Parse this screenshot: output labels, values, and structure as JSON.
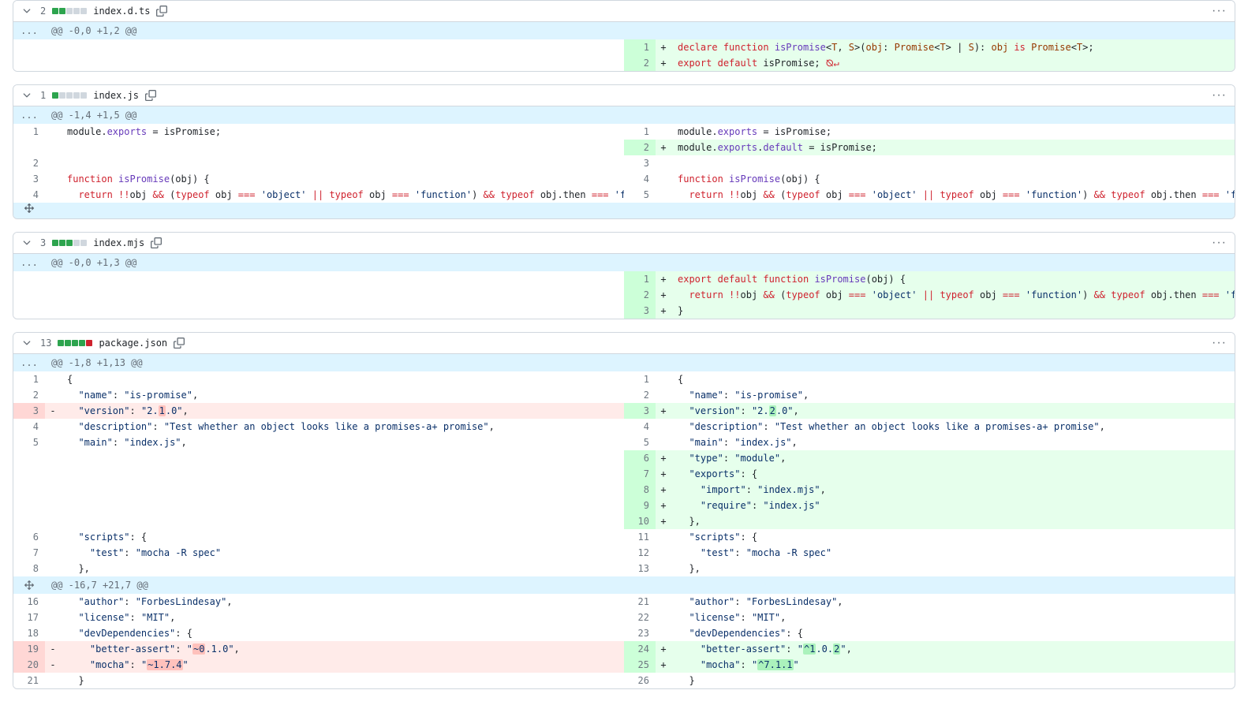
{
  "files": [
    {
      "id": "f0",
      "filename": "index.d.ts",
      "change_count": "2",
      "blocks": [
        "add",
        "add",
        "neutral",
        "neutral",
        "neutral"
      ],
      "hunks": [
        {
          "header": "@@ -0,0 +1,2 @@",
          "left": [],
          "right": [
            {
              "n": "1",
              "m": "+",
              "type": "add",
              "html": "<span class='kw'>declare</span> <span class='kw'>function</span> <span class='fn'>isPromise</span>&lt;<span class='type'>T</span>, <span class='type'>S</span>&gt;(<span class='type'>obj</span>: <span class='type'>Promise</span>&lt;<span class='type'>T</span>&gt; | <span class='type'>S</span>): <span class='type'>obj</span> <span class='kw'>is</span> <span class='type'>Promise</span>&lt;<span class='type'>T</span>&gt;;"
            },
            {
              "n": "2",
              "m": "+",
              "type": "add",
              "html": "<span class='kw'>export</span> <span class='kw'>default</span> isPromise; <span class='nl-icon'>⦰↵</span>"
            }
          ]
        }
      ]
    },
    {
      "id": "f1",
      "filename": "index.js",
      "change_count": "1",
      "blocks": [
        "add",
        "neutral",
        "neutral",
        "neutral",
        "neutral"
      ],
      "hunks": [
        {
          "header": "@@ -1,4 +1,5 @@",
          "rows": [
            {
              "ln": "1",
              "lm": "",
              "lt": "ctx",
              "lh": "module.<span class='fn'>exports</span> = isPromise;",
              "rn": "1",
              "rm": "",
              "rt": "ctx",
              "rh": "module.<span class='fn'>exports</span> = isPromise;"
            },
            {
              "ln": "",
              "lm": "",
              "lt": "empty",
              "lh": "",
              "rn": "2",
              "rm": "+",
              "rt": "add",
              "rh": "module.<span class='fn'>exports</span>.<span class='fn'>default</span> = isPromise;"
            },
            {
              "ln": "2",
              "lm": "",
              "lt": "ctx",
              "lh": "",
              "rn": "3",
              "rm": "",
              "rt": "ctx",
              "rh": ""
            },
            {
              "ln": "3",
              "lm": "",
              "lt": "ctx",
              "lh": "<span class='kw'>function</span> <span class='fn'>isPromise</span>(obj) {",
              "rn": "4",
              "rm": "",
              "rt": "ctx",
              "rh": "<span class='kw'>function</span> <span class='fn'>isPromise</span>(obj) {"
            },
            {
              "ln": "4",
              "lm": "",
              "lt": "ctx",
              "lh": "  <span class='kw'>return</span> <span class='op'>!!</span>obj <span class='op'>&amp;&amp;</span> (<span class='kw'>typeof</span> obj <span class='op'>===</span> <span class='str'>'object'</span> <span class='op'>||</span> <span class='kw'>typeof</span> obj <span class='op'>===</span> <span class='str'>'function'</span>) <span class='op'>&amp;&amp;</span> <span class='kw'>typeof</span> obj.then <span class='op'>===</span> <span class='str'>'function'</span>;",
              "rn": "5",
              "rm": "",
              "rt": "ctx",
              "rh": "  <span class='kw'>return</span> <span class='op'>!!</span>obj <span class='op'>&amp;&amp;</span> (<span class='kw'>typeof</span> obj <span class='op'>===</span> <span class='str'>'object'</span> <span class='op'>||</span> <span class='kw'>typeof</span> obj <span class='op'>===</span> <span class='str'>'function'</span>) <span class='op'>&amp;&amp;</span> <span class='kw'>typeof</span> obj.then <span class='op'>===</span> <span class='str'>'function'</span>;"
            }
          ],
          "trailing_expand": true
        }
      ]
    },
    {
      "id": "f2",
      "filename": "index.mjs",
      "change_count": "3",
      "blocks": [
        "add",
        "add",
        "add",
        "neutral",
        "neutral"
      ],
      "hunks": [
        {
          "header": "@@ -0,0 +1,3 @@",
          "left": [],
          "right": [
            {
              "n": "1",
              "m": "+",
              "type": "add",
              "html": "<span class='kw'>export</span> <span class='kw'>default</span> <span class='kw'>function</span> <span class='fn'>isPromise</span>(obj) {"
            },
            {
              "n": "2",
              "m": "+",
              "type": "add",
              "html": "  <span class='kw'>return</span> <span class='op'>!!</span>obj <span class='op'>&amp;&amp;</span> (<span class='kw'>typeof</span> obj <span class='op'>===</span> <span class='str'>'object'</span> <span class='op'>||</span> <span class='kw'>typeof</span> obj <span class='op'>===</span> <span class='str'>'function'</span>) <span class='op'>&amp;&amp;</span> <span class='kw'>typeof</span> obj.then <span class='op'>===</span> <span class='str'>'function'</span>;"
            },
            {
              "n": "3",
              "m": "+",
              "type": "add",
              "html": "}"
            }
          ]
        }
      ]
    },
    {
      "id": "f3",
      "filename": "package.json",
      "change_count": "13",
      "blocks": [
        "add",
        "add",
        "add",
        "add",
        "del"
      ],
      "hunks": [
        {
          "header": "@@ -1,8 +1,13 @@",
          "rows": [
            {
              "ln": "1",
              "lm": "",
              "lt": "ctx",
              "lh": "{",
              "rn": "1",
              "rm": "",
              "rt": "ctx",
              "rh": "{"
            },
            {
              "ln": "2",
              "lm": "",
              "lt": "ctx",
              "lh": "  <span class='str'>\"name\"</span>: <span class='str'>\"is-promise\"</span>,",
              "rn": "2",
              "rm": "",
              "rt": "ctx",
              "rh": "  <span class='str'>\"name\"</span>: <span class='str'>\"is-promise\"</span>,"
            },
            {
              "ln": "3",
              "lm": "-",
              "lt": "del",
              "lh": "  <span class='str'>\"version\"</span>: <span class='str'>\"2.<span class='hl-red'>1</span>.0\"</span>,",
              "rn": "3",
              "rm": "+",
              "rt": "add",
              "rh": "  <span class='str'>\"version\"</span>: <span class='str'>\"2.<span class='hl-grn'>2</span>.0\"</span>,"
            },
            {
              "ln": "4",
              "lm": "",
              "lt": "ctx",
              "lh": "  <span class='str'>\"description\"</span>: <span class='str'>\"Test whether an object looks like a promises-a+ promise\"</span>,",
              "rn": "4",
              "rm": "",
              "rt": "ctx",
              "rh": "  <span class='str'>\"description\"</span>: <span class='str'>\"Test whether an object looks like a promises-a+ promise\"</span>,"
            },
            {
              "ln": "5",
              "lm": "",
              "lt": "ctx",
              "lh": "  <span class='str'>\"main\"</span>: <span class='str'>\"index.js\"</span>,",
              "rn": "5",
              "rm": "",
              "rt": "ctx",
              "rh": "  <span class='str'>\"main\"</span>: <span class='str'>\"index.js\"</span>,"
            },
            {
              "ln": "",
              "lm": "",
              "lt": "empty",
              "lh": "",
              "rn": "6",
              "rm": "+",
              "rt": "add",
              "rh": "  <span class='str'>\"type\"</span>: <span class='str'>\"module\"</span>,"
            },
            {
              "ln": "",
              "lm": "",
              "lt": "empty",
              "lh": "",
              "rn": "7",
              "rm": "+",
              "rt": "add",
              "rh": "  <span class='str'>\"exports\"</span>: {"
            },
            {
              "ln": "",
              "lm": "",
              "lt": "empty",
              "lh": "",
              "rn": "8",
              "rm": "+",
              "rt": "add",
              "rh": "    <span class='str'>\"import\"</span>: <span class='str'>\"index.mjs\"</span>,"
            },
            {
              "ln": "",
              "lm": "",
              "lt": "empty",
              "lh": "",
              "rn": "9",
              "rm": "+",
              "rt": "add",
              "rh": "    <span class='str'>\"require\"</span>: <span class='str'>\"index.js\"</span>"
            },
            {
              "ln": "",
              "lm": "",
              "lt": "empty",
              "lh": "",
              "rn": "10",
              "rm": "+",
              "rt": "add",
              "rh": "  },"
            },
            {
              "ln": "6",
              "lm": "",
              "lt": "ctx",
              "lh": "  <span class='str'>\"scripts\"</span>: {",
              "rn": "11",
              "rm": "",
              "rt": "ctx",
              "rh": "  <span class='str'>\"scripts\"</span>: {"
            },
            {
              "ln": "7",
              "lm": "",
              "lt": "ctx",
              "lh": "    <span class='str'>\"test\"</span>: <span class='str'>\"mocha -R spec\"</span>",
              "rn": "12",
              "rm": "",
              "rt": "ctx",
              "rh": "    <span class='str'>\"test\"</span>: <span class='str'>\"mocha -R spec\"</span>"
            },
            {
              "ln": "8",
              "lm": "",
              "lt": "ctx",
              "lh": "  },",
              "rn": "13",
              "rm": "",
              "rt": "ctx",
              "rh": "  },"
            }
          ]
        },
        {
          "header": "@@ -16,7 +21,7 @@",
          "expand_icon": true,
          "rows": [
            {
              "ln": "16",
              "lm": "",
              "lt": "ctx",
              "lh": "  <span class='str'>\"author\"</span>: <span class='str'>\"ForbesLindesay\"</span>,",
              "rn": "21",
              "rm": "",
              "rt": "ctx",
              "rh": "  <span class='str'>\"author\"</span>: <span class='str'>\"ForbesLindesay\"</span>,"
            },
            {
              "ln": "17",
              "lm": "",
              "lt": "ctx",
              "lh": "  <span class='str'>\"license\"</span>: <span class='str'>\"MIT\"</span>,",
              "rn": "22",
              "rm": "",
              "rt": "ctx",
              "rh": "  <span class='str'>\"license\"</span>: <span class='str'>\"MIT\"</span>,"
            },
            {
              "ln": "18",
              "lm": "",
              "lt": "ctx",
              "lh": "  <span class='str'>\"devDependencies\"</span>: {",
              "rn": "23",
              "rm": "",
              "rt": "ctx",
              "rh": "  <span class='str'>\"devDependencies\"</span>: {"
            },
            {
              "ln": "19",
              "lm": "-",
              "lt": "del",
              "lh": "    <span class='str'>\"better-assert\"</span>: <span class='str'>\"<span class='hl-red'>~0</span>.1.0\"</span>,",
              "rn": "24",
              "rm": "+",
              "rt": "add",
              "rh": "    <span class='str'>\"better-assert\"</span>: <span class='str'>\"<span class='hl-grn'>^1</span>.0.<span class='hl-grn'>2</span>\"</span>,"
            },
            {
              "ln": "20",
              "lm": "-",
              "lt": "del",
              "lh": "    <span class='str'>\"mocha\"</span>: <span class='str'>\"<span class='hl-red'>~1.7.4</span>\"</span>",
              "rn": "25",
              "rm": "+",
              "rt": "add",
              "rh": "    <span class='str'>\"mocha\"</span>: <span class='str'>\"<span class='hl-grn'>^7.1.1</span>\"</span>"
            },
            {
              "ln": "21",
              "lm": "",
              "lt": "ctx",
              "lh": "  }",
              "rn": "26",
              "rm": "",
              "rt": "ctx",
              "rh": "  }"
            }
          ]
        }
      ]
    }
  ],
  "icons": {
    "ellipsis": "...",
    "kebab": "···"
  }
}
